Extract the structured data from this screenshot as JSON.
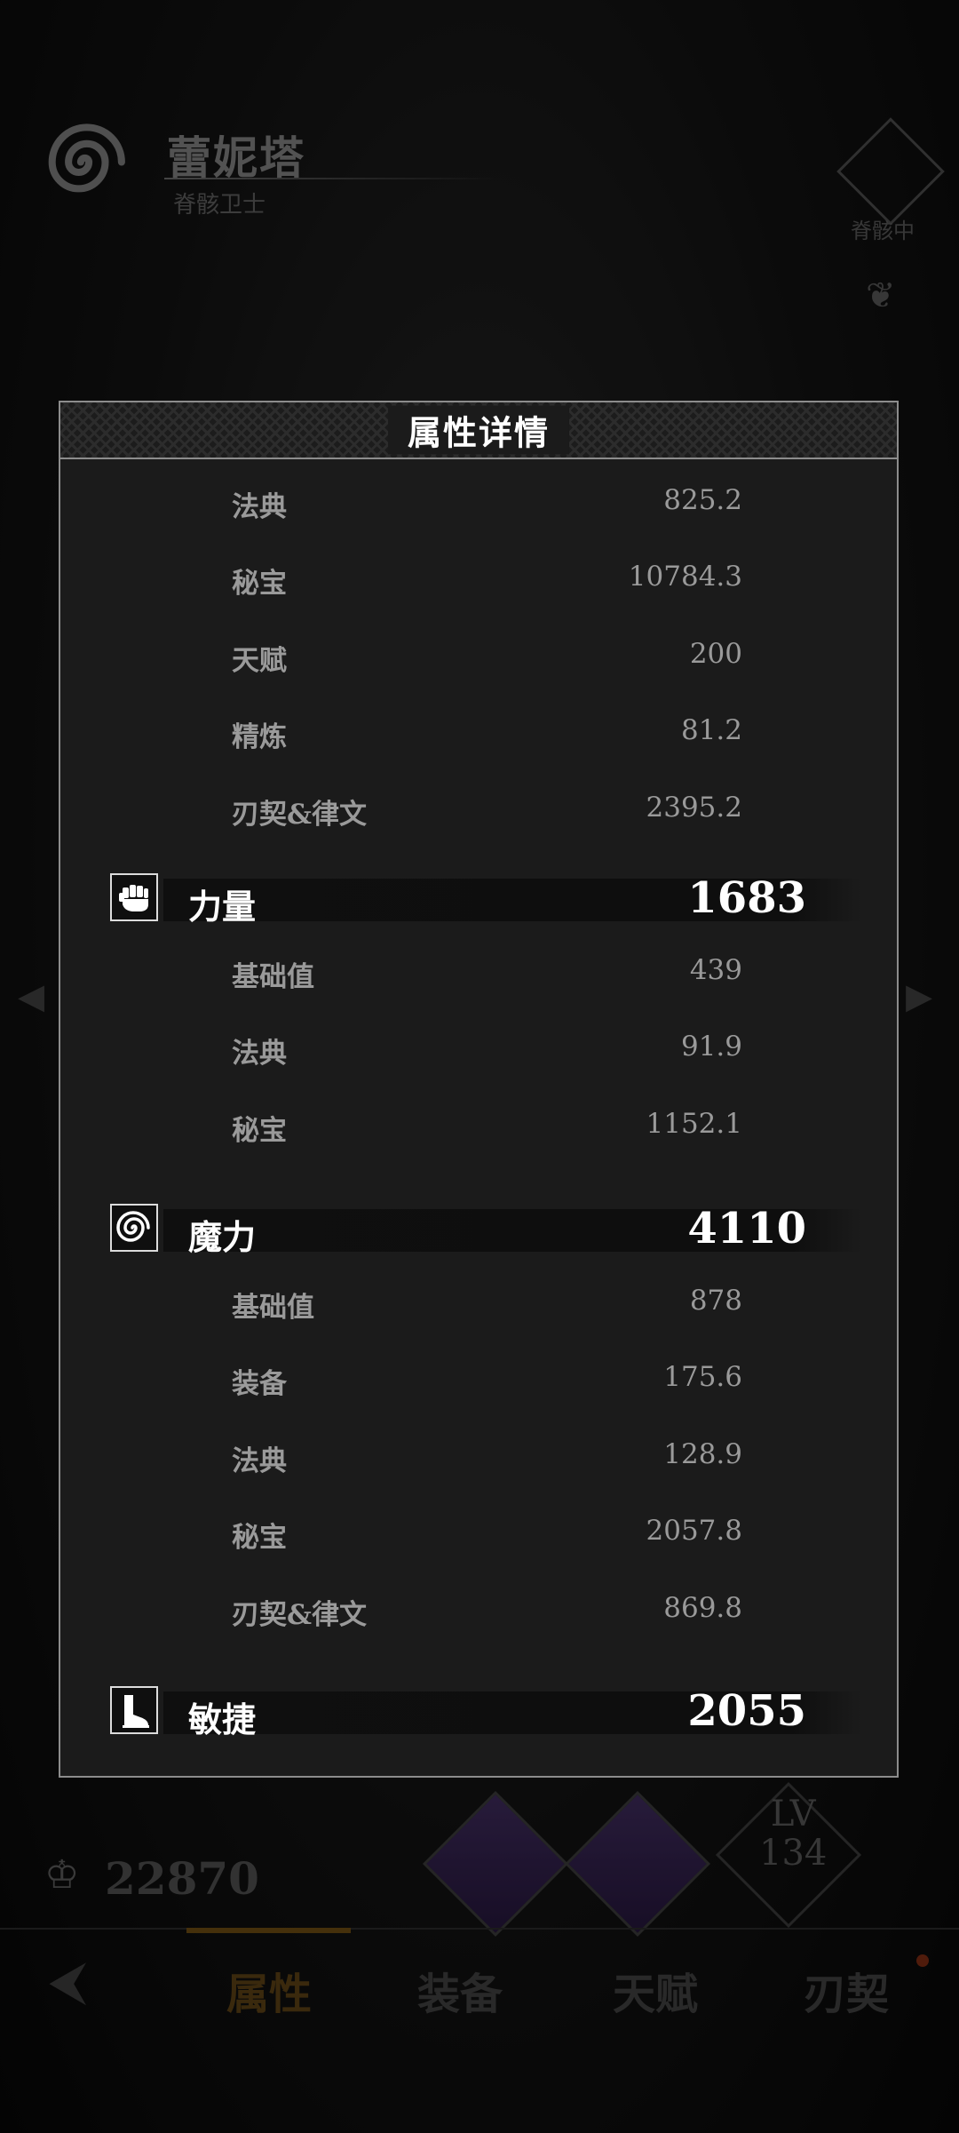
{
  "background": {
    "character_name": "蕾妮塔",
    "character_subtitle": "脊骸卫士",
    "status_text": "脊骸中",
    "power_value": "22870",
    "skill_level_label": "LV",
    "skill_level_value": "134",
    "tabs": [
      {
        "label": "属性",
        "active": true
      },
      {
        "label": "装备",
        "active": false
      },
      {
        "label": "天赋",
        "active": false
      },
      {
        "label": "刃契",
        "active": false
      }
    ]
  },
  "modal": {
    "title": "属性详情",
    "sections": [
      {
        "header": null,
        "rows": [
          {
            "label": "法典",
            "value": "825.2"
          },
          {
            "label": "秘宝",
            "value": "10784.3"
          },
          {
            "label": "天赋",
            "value": "200"
          },
          {
            "label": "精炼",
            "value": "81.2"
          },
          {
            "label": "刃契&律文",
            "value": "2395.2"
          }
        ]
      },
      {
        "header": {
          "icon": "fist-icon",
          "label": "力量",
          "value": "1683"
        },
        "rows": [
          {
            "label": "基础值",
            "value": "439"
          },
          {
            "label": "法典",
            "value": "91.9"
          },
          {
            "label": "秘宝",
            "value": "1152.1"
          }
        ]
      },
      {
        "header": {
          "icon": "spiral-icon",
          "label": "魔力",
          "value": "4110"
        },
        "rows": [
          {
            "label": "基础值",
            "value": "878"
          },
          {
            "label": "装备",
            "value": "175.6"
          },
          {
            "label": "法典",
            "value": "128.9"
          },
          {
            "label": "秘宝",
            "value": "2057.8"
          },
          {
            "label": "刃契&律文",
            "value": "869.8"
          }
        ]
      },
      {
        "header": {
          "icon": "boot-icon",
          "label": "敏捷",
          "value": "2055"
        },
        "rows": []
      }
    ]
  }
}
